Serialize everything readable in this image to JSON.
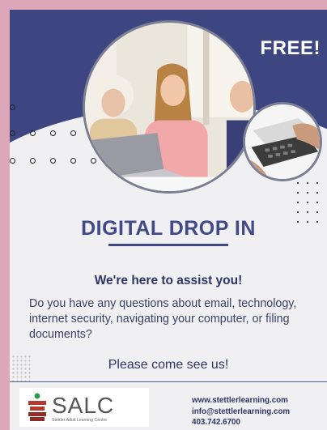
{
  "badge": {
    "free": "FREE!"
  },
  "flyer": {
    "title": "DIGITAL DROP IN",
    "subtitle": "We're here to assist you!",
    "body": "Do you have any questions about email, technology, internet security, navigating your computer, or filing documents?",
    "cta": "Please come see us!"
  },
  "logo": {
    "wordmark": "SALC",
    "name": "Stettler Adult Learning Centre"
  },
  "contact": {
    "website": "www.stettlerlearning.com",
    "email": "info@stettlerlearning.com",
    "phone": "403.742.6700"
  },
  "colors": {
    "frame": "#dca7b8",
    "navy": "#3e4682",
    "heading": "#414a86",
    "background": "#f0f0f2"
  }
}
